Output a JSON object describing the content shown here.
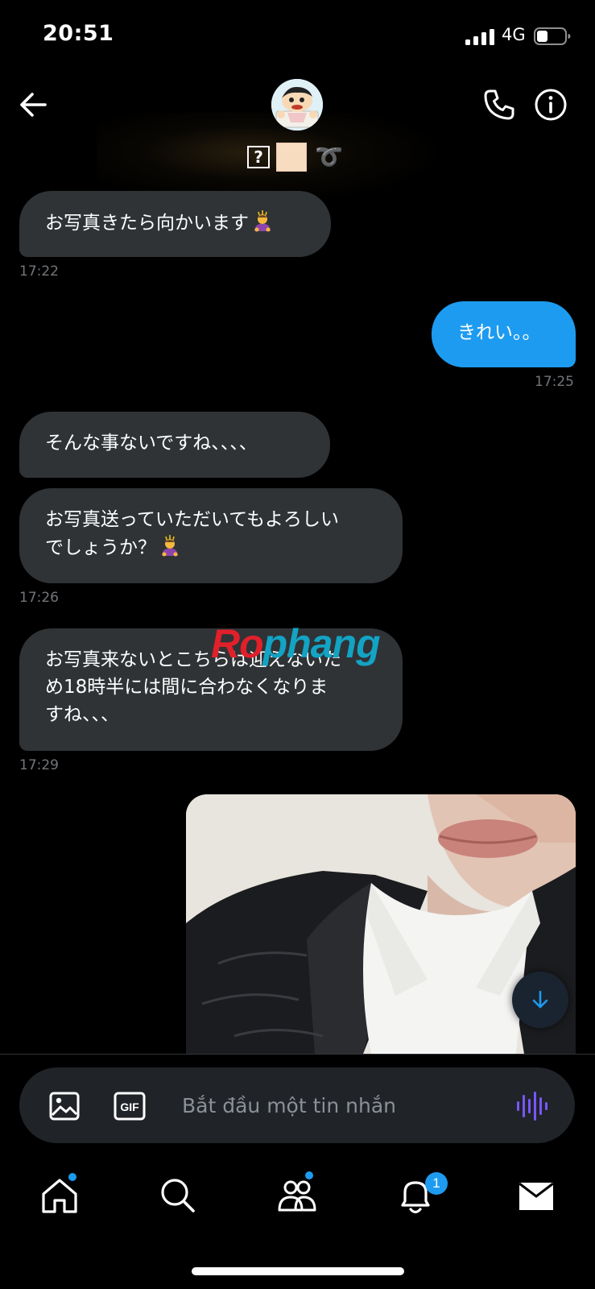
{
  "status_bar": {
    "time": "20:51",
    "network": "4G"
  },
  "messages": [
    {
      "direction": "in",
      "text": "お写真きたら向かいます",
      "emoji": "person-bowing",
      "time": "17:22"
    },
    {
      "direction": "out",
      "text": "きれい。。",
      "time": "17:25"
    },
    {
      "direction": "in",
      "text": "そんな事ないですね、、、、"
    },
    {
      "direction": "in",
      "lines": [
        "お写真送っていただいてもよろしい",
        "でしょうか？"
      ],
      "emoji": "person-bowing",
      "time": "17:26"
    },
    {
      "direction": "in",
      "lines": [
        "お写真来ないとこちらは迎えないた",
        "め18時半には間に合わなくなりま",
        "すね、、、"
      ],
      "time": "17:29"
    },
    {
      "direction": "out",
      "type": "photo"
    }
  ],
  "watermark": {
    "part1": "Ro",
    "part2": "phang"
  },
  "composer": {
    "placeholder": "Bắt đầu một tin nhắn"
  },
  "tabs": [
    {
      "name": "home",
      "icon": "home-icon",
      "has_dot": true
    },
    {
      "name": "search",
      "icon": "search-icon",
      "has_dot": false
    },
    {
      "name": "communities",
      "icon": "people-icon",
      "has_dot": true
    },
    {
      "name": "notifications",
      "icon": "bell-icon",
      "badge": "1"
    },
    {
      "name": "messages",
      "icon": "mail-icon",
      "active": true
    }
  ],
  "colors": {
    "accent": "#1d9bf0",
    "incoming_bubble": "#2f3336",
    "timestamp": "#71767b",
    "voice": "#7856ff"
  }
}
